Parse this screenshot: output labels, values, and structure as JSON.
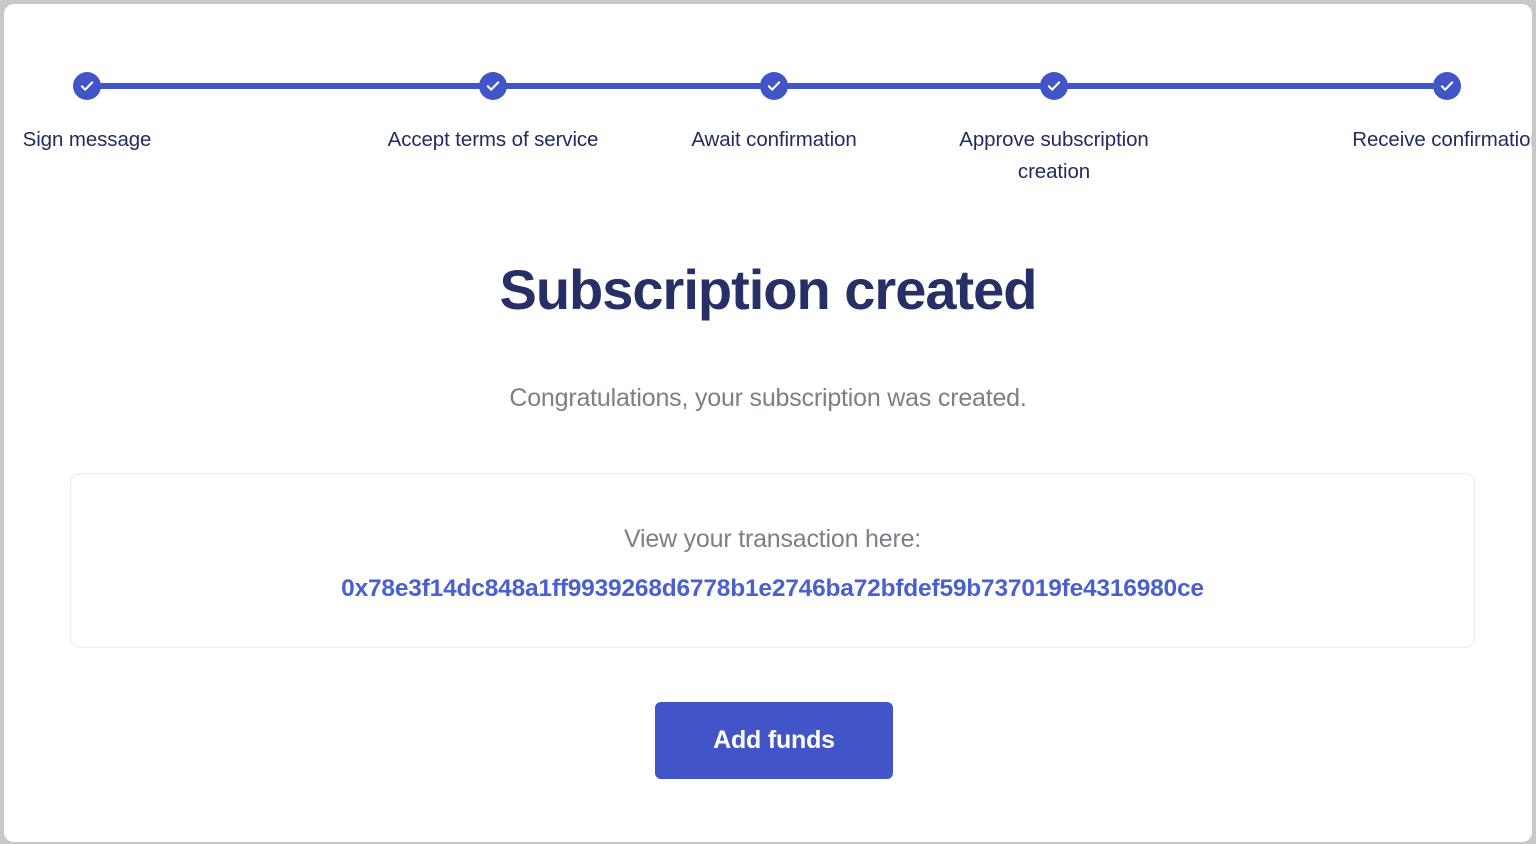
{
  "theme": {
    "accent_blue": "#4154c8",
    "title_navy": "#262f66",
    "label_navy": "#222c63",
    "muted_gray": "#7a7f8a",
    "link_blue": "#4a5fd0",
    "panel_border": "#ececec",
    "card_background": "#ffffff",
    "page_background": "#c8c8c8"
  },
  "stepper": {
    "steps": [
      {
        "label": "Sign message",
        "state": "completed",
        "icon": "check-icon"
      },
      {
        "label": "Accept terms of service",
        "state": "completed",
        "icon": "check-icon"
      },
      {
        "label": "Await confirmation",
        "state": "completed",
        "icon": "check-icon"
      },
      {
        "label": "Approve subscription\ncreation",
        "state": "completed",
        "icon": "check-icon"
      },
      {
        "label": "Receive confirmation",
        "state": "completed",
        "icon": "check-icon"
      }
    ]
  },
  "main": {
    "headline": "Subscription created",
    "subtitle": "Congratulations, your subscription was created."
  },
  "transaction": {
    "caption": "View your transaction here:",
    "hash": "0x78e3f14dc848a1ff9939268d6778b1e2746ba72bfdef59b737019fe4316980ce"
  },
  "actions": {
    "primary_label": "Add funds"
  }
}
